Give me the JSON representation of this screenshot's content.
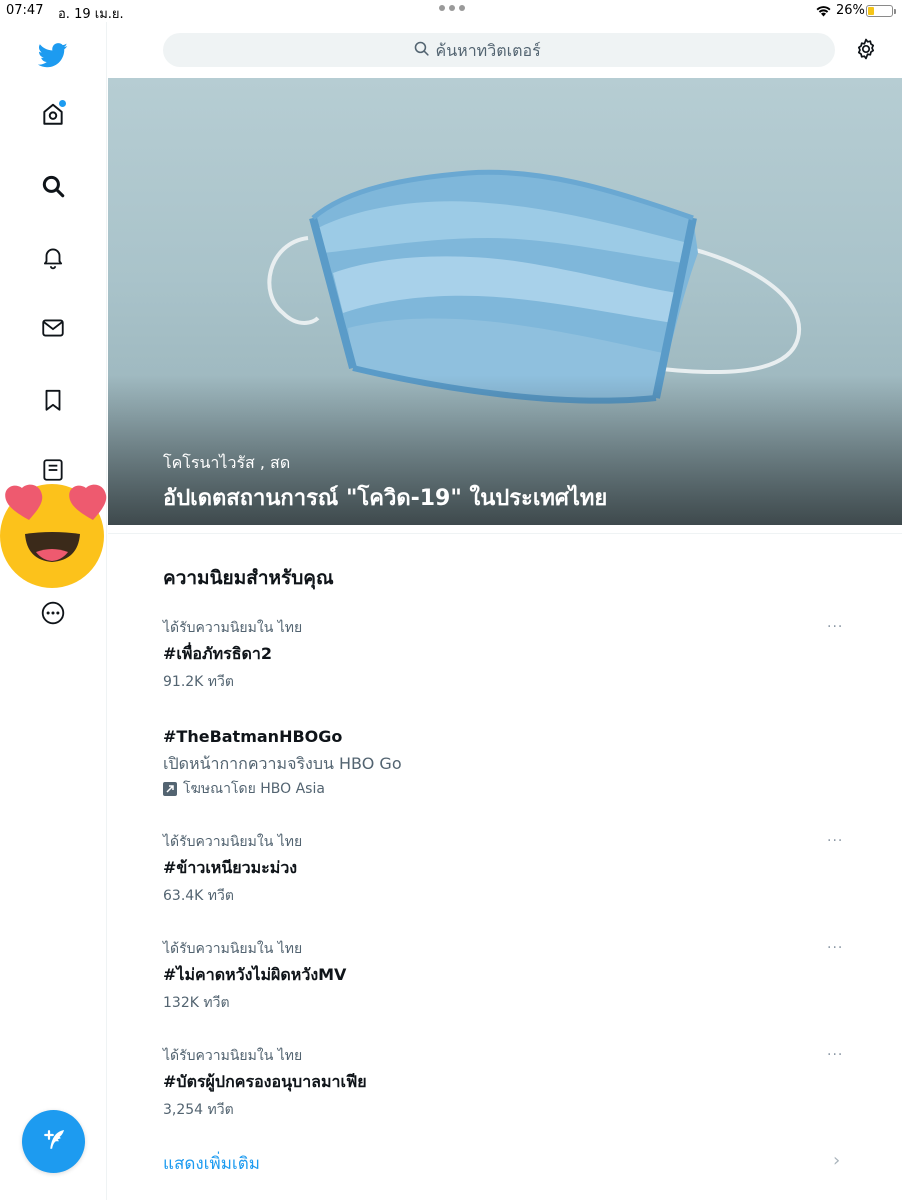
{
  "status_bar": {
    "time": "07:47",
    "date": "อ. 19 เม.ย.",
    "battery_percent": "26%",
    "battery_level": 0.26
  },
  "sidebar": {
    "items": [
      {
        "name": "home",
        "icon": "home-icon",
        "badge": true
      },
      {
        "name": "explore",
        "icon": "search-icon"
      },
      {
        "name": "notifications",
        "icon": "bell-icon"
      },
      {
        "name": "messages",
        "icon": "envelope-icon"
      },
      {
        "name": "bookmarks",
        "icon": "bookmark-icon"
      },
      {
        "name": "lists",
        "icon": "list-icon"
      },
      {
        "name": "more",
        "icon": "more-circle-icon"
      }
    ],
    "compose_icon": "compose-feather-icon"
  },
  "search": {
    "placeholder": "ค้นหาทวิตเตอร์"
  },
  "hero": {
    "kicker": "โคโรนาไวรัส , สด",
    "title": "อัปเดตสถานการณ์ \"โควิด-19\" ในประเทศไทย"
  },
  "trends": {
    "section_title": "ความนิยมสำหรับคุณ",
    "items": [
      {
        "meta": "ได้รับความนิยมใน ไทย",
        "name": "#เพื่อภัทรธิดา2",
        "count": "91.2K ทวีต"
      },
      {
        "name": "#TheBatmanHBOGo",
        "description": "เปิดหน้ากากความจริงบน HBO Go",
        "promoted": "โฆษณาโดย HBO Asia"
      },
      {
        "meta": "ได้รับความนิยมใน ไทย",
        "name": "#ข้าวเหนียวมะม่วง",
        "count": "63.4K ทวีต"
      },
      {
        "meta": "ได้รับความนิยมใน ไทย",
        "name": "#ไม่คาดหวังไม่ผิดหวังMV",
        "count": "132K ทวีต"
      },
      {
        "meta": "ได้รับความนิยมใน ไทย",
        "name": "#บัตรผู้ปกครองอนุบาลมาเฟีย",
        "count": "3,254 ทวีต"
      }
    ],
    "more_glyph": "···",
    "show_more": "แสดงเพิ่มเติม"
  },
  "colors": {
    "accent": "#1d9bf0",
    "text_primary": "#0f1419",
    "text_secondary": "#536471"
  }
}
